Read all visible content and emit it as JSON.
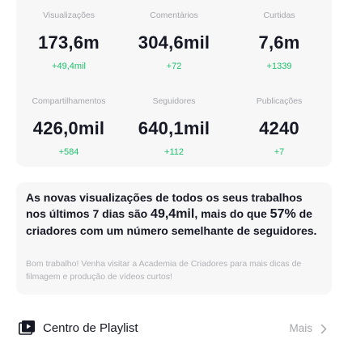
{
  "stats": [
    {
      "label": "Visualizações",
      "value": "173,6m",
      "delta": "+49,4mil"
    },
    {
      "label": "Comentários",
      "value": "304,6mil",
      "delta": "+72"
    },
    {
      "label": "Curtidas",
      "value": "7,6m",
      "delta": "+1339"
    },
    {
      "label": "Compartilhamentos",
      "value": "426,0mil",
      "delta": "+584"
    },
    {
      "label": "Seguidores",
      "value": "640,1mil",
      "delta": "+112"
    },
    {
      "label": "Publicações",
      "value": "4240",
      "delta": "+7"
    }
  ],
  "insight": {
    "part1": "As novas visualizações de todos os seus trabalhos nos últimos 7 dias são ",
    "views": "49,4mil",
    "part2": ", mais do que ",
    "percent": "57%",
    "part3": " de criadores com um número semelhante de seguidores.",
    "sub": "Bom trabalho! Venha visitar a Academia de Criadores para mais dicas de filmagem e produção de vídeos curtos!"
  },
  "playlist": {
    "title": "Centro de Playlist",
    "more": "Mais"
  },
  "colors": {
    "positive": "#1ec16b",
    "card": "#f7f7f8",
    "muted": "#a6a7ab"
  }
}
